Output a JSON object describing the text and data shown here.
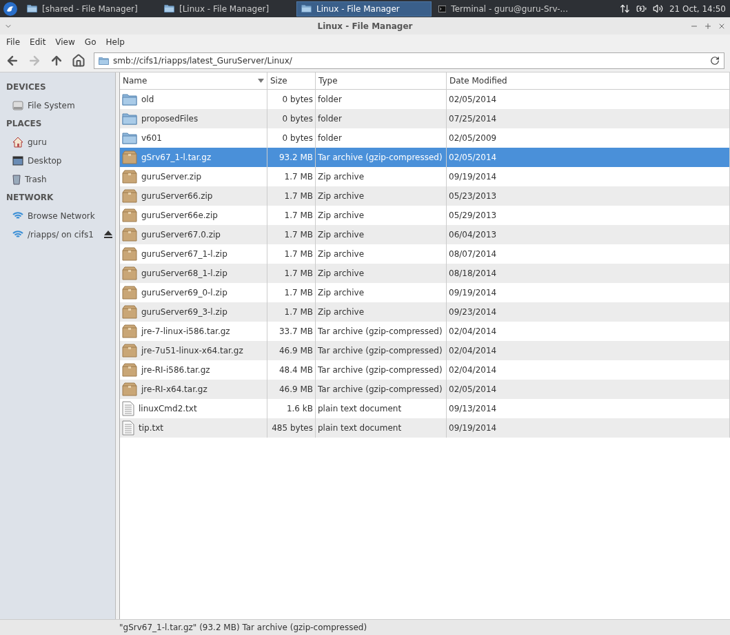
{
  "taskbar": {
    "tasks": [
      {
        "label": "[shared - File Manager]",
        "kind": "folder",
        "selected": false
      },
      {
        "label": "[Linux - File Manager]",
        "kind": "folder",
        "selected": false
      },
      {
        "label": "Linux - File Manager",
        "kind": "folder",
        "selected": true
      },
      {
        "label": "Terminal - guru@guru-Srv-...",
        "kind": "terminal",
        "selected": false
      }
    ],
    "clock": "21 Oct, 14:50"
  },
  "window": {
    "title": "Linux - File Manager"
  },
  "menu": [
    "File",
    "Edit",
    "View",
    "Go",
    "Help"
  ],
  "location": {
    "value": "smb://cifs1/riapps/latest_GuruServer/Linux/"
  },
  "sidebar": [
    {
      "heading": "DEVICES",
      "items": [
        {
          "label": "File System",
          "kind": "drive",
          "eject": false
        }
      ]
    },
    {
      "heading": "PLACES",
      "items": [
        {
          "label": "guru",
          "kind": "home",
          "eject": false
        },
        {
          "label": "Desktop",
          "kind": "desktop",
          "eject": false
        },
        {
          "label": "Trash",
          "kind": "trash",
          "eject": false
        }
      ]
    },
    {
      "heading": "NETWORK",
      "items": [
        {
          "label": "Browse Network",
          "kind": "network",
          "eject": false
        },
        {
          "label": "/riapps/ on cifs1",
          "kind": "network",
          "eject": true
        }
      ]
    }
  ],
  "table": {
    "columns": [
      "Name",
      "Size",
      "Type",
      "Date Modified"
    ],
    "rows": [
      {
        "name": "old",
        "size": "0 bytes",
        "type": "folder",
        "date": "02/05/2014",
        "kind": "folder",
        "selected": false
      },
      {
        "name": "proposedFiles",
        "size": "0 bytes",
        "type": "folder",
        "date": "07/25/2014",
        "kind": "folder",
        "selected": false
      },
      {
        "name": "v601",
        "size": "0 bytes",
        "type": "folder",
        "date": "02/05/2009",
        "kind": "folder",
        "selected": false
      },
      {
        "name": "gSrv67_1-l.tar.gz",
        "size": "93.2 MB",
        "type": "Tar archive (gzip-compressed)",
        "date": "02/05/2014",
        "kind": "archive",
        "selected": true
      },
      {
        "name": "guruServer.zip",
        "size": "1.7 MB",
        "type": "Zip archive",
        "date": "09/19/2014",
        "kind": "archive",
        "selected": false
      },
      {
        "name": "guruServer66.zip",
        "size": "1.7 MB",
        "type": "Zip archive",
        "date": "05/23/2013",
        "kind": "archive",
        "selected": false
      },
      {
        "name": "guruServer66e.zip",
        "size": "1.7 MB",
        "type": "Zip archive",
        "date": "05/29/2013",
        "kind": "archive",
        "selected": false
      },
      {
        "name": "guruServer67.0.zip",
        "size": "1.7 MB",
        "type": "Zip archive",
        "date": "06/04/2013",
        "kind": "archive",
        "selected": false
      },
      {
        "name": "guruServer67_1-l.zip",
        "size": "1.7 MB",
        "type": "Zip archive",
        "date": "08/07/2014",
        "kind": "archive",
        "selected": false
      },
      {
        "name": "guruServer68_1-l.zip",
        "size": "1.7 MB",
        "type": "Zip archive",
        "date": "08/18/2014",
        "kind": "archive",
        "selected": false
      },
      {
        "name": "guruServer69_0-l.zip",
        "size": "1.7 MB",
        "type": "Zip archive",
        "date": "09/19/2014",
        "kind": "archive",
        "selected": false
      },
      {
        "name": "guruServer69_3-l.zip",
        "size": "1.7 MB",
        "type": "Zip archive",
        "date": "09/23/2014",
        "kind": "archive",
        "selected": false
      },
      {
        "name": "jre-7-linux-i586.tar.gz",
        "size": "33.7 MB",
        "type": "Tar archive (gzip-compressed)",
        "date": "02/04/2014",
        "kind": "archive",
        "selected": false
      },
      {
        "name": "jre-7u51-linux-x64.tar.gz",
        "size": "46.9 MB",
        "type": "Tar archive (gzip-compressed)",
        "date": "02/04/2014",
        "kind": "archive",
        "selected": false
      },
      {
        "name": "jre-RI-i586.tar.gz",
        "size": "48.4 MB",
        "type": "Tar archive (gzip-compressed)",
        "date": "02/04/2014",
        "kind": "archive",
        "selected": false
      },
      {
        "name": "jre-RI-x64.tar.gz",
        "size": "46.9 MB",
        "type": "Tar archive (gzip-compressed)",
        "date": "02/05/2014",
        "kind": "archive",
        "selected": false
      },
      {
        "name": "linuxCmd2.txt",
        "size": "1.6 kB",
        "type": "plain text document",
        "date": "09/13/2014",
        "kind": "text",
        "selected": false
      },
      {
        "name": "tip.txt",
        "size": "485 bytes",
        "type": "plain text document",
        "date": "09/19/2014",
        "kind": "text",
        "selected": false
      }
    ]
  },
  "status_bar": "\"gSrv67_1-l.tar.gz\" (93.2 MB) Tar archive (gzip-compressed)"
}
